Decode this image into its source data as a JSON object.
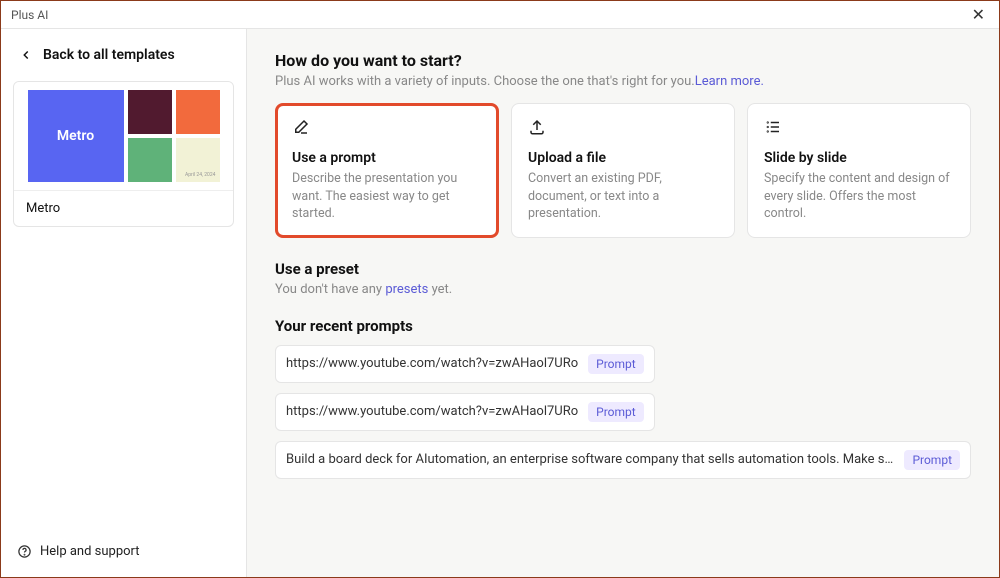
{
  "window": {
    "title": "Plus AI"
  },
  "sidebar": {
    "back_label": "Back to all templates",
    "template_name": "Metro",
    "thumb_label": "Metro",
    "thumb_date": "April 24, 2024",
    "help_label": "Help and support"
  },
  "main": {
    "heading": "How do you want to start?",
    "subtitle_text": "Plus AI works with a variety of inputs. Choose the one that's right for you.",
    "learn_more": "Learn more.",
    "cards": [
      {
        "title": "Use a prompt",
        "desc": "Describe the presentation you want. The easiest way to get started."
      },
      {
        "title": "Upload a file",
        "desc": "Convert an existing PDF, document, or text into a presentation."
      },
      {
        "title": "Slide by slide",
        "desc": "Specify the content and design of every slide. Offers the most control."
      }
    ],
    "preset_heading": "Use a preset",
    "preset_sub_prefix": "You don't have any ",
    "preset_link": "presets",
    "preset_sub_suffix": " yet.",
    "recent_heading": "Your recent prompts",
    "recent": [
      {
        "text": "https://www.youtube.com/watch?v=zwAHaol7URo",
        "badge": "Prompt"
      },
      {
        "text": "https://www.youtube.com/watch?v=zwAHaol7URo",
        "badge": "Prompt"
      },
      {
        "text": "Build a board deck for AIutomation, an enterprise software company that sells automation tools. Make sure to start with a C…",
        "badge": "Prompt"
      }
    ]
  }
}
